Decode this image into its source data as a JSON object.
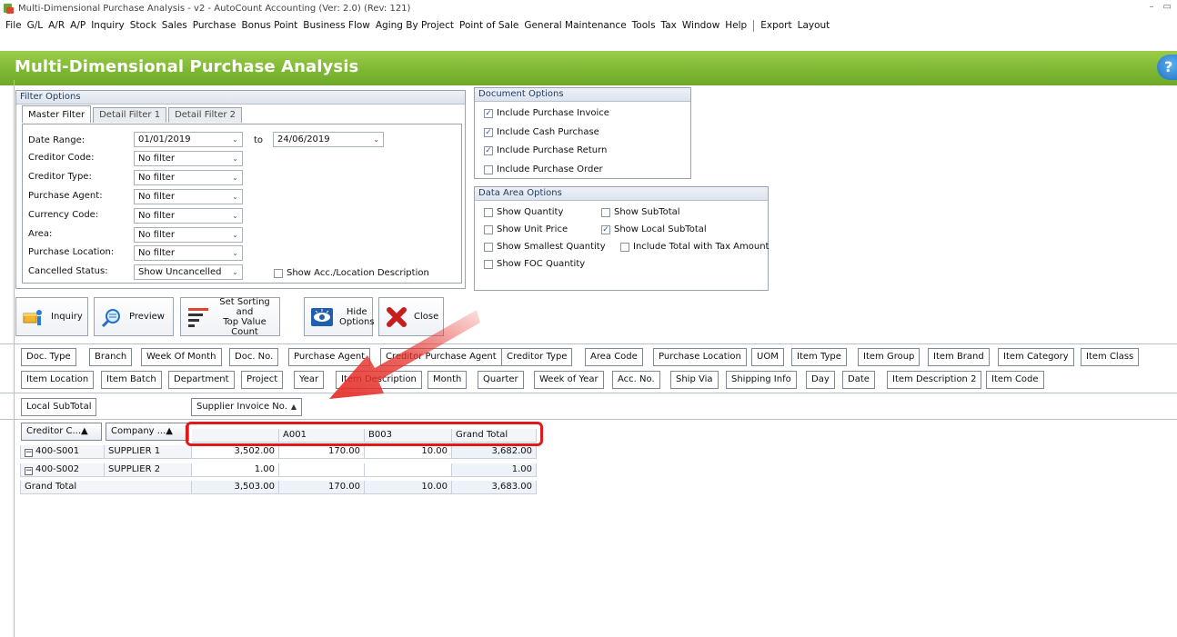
{
  "window": {
    "title": "Multi-Dimensional Purchase Analysis - v2 - AutoCount Accounting (Ver: 2.0) (Rev: 121)",
    "controls": [
      "–",
      "▭"
    ]
  },
  "menu": {
    "items_a": [
      "File",
      "G/L",
      "A/R",
      "A/P",
      "Inquiry",
      "Stock",
      "Sales",
      "Purchase",
      "Bonus Point",
      "Business Flow",
      "Aging By Project",
      "Point of Sale",
      "General Maintenance",
      "Tools",
      "Tax",
      "Window",
      "Help"
    ],
    "items_b": [
      "Export",
      "Layout"
    ]
  },
  "banner": {
    "title": "Multi-Dimensional Purchase Analysis",
    "help": "?"
  },
  "filter_options": {
    "header": "Filter Options",
    "tabs": [
      "Master Filter",
      "Detail Filter 1",
      "Detail Filter 2"
    ],
    "rows": [
      {
        "label": "Date Range:",
        "value": "01/01/2019"
      },
      {
        "label": "Creditor Code:",
        "value": "No filter"
      },
      {
        "label": "Creditor Type:",
        "value": "No filter"
      },
      {
        "label": "Purchase Agent:",
        "value": "No filter"
      },
      {
        "label": "Currency Code:",
        "value": "No filter"
      },
      {
        "label": "Area:",
        "value": "No filter"
      },
      {
        "label": "Purchase Location:",
        "value": "No filter"
      },
      {
        "label": "Cancelled Status:",
        "value": "Show Uncancelled"
      }
    ],
    "to_label": "to",
    "date_to": "24/06/2019",
    "show_acc_location": {
      "label": "Show Acc./Location Description",
      "checked": false
    }
  },
  "document_options": {
    "header": "Document Options",
    "items": [
      {
        "label": "Include Purchase Invoice",
        "checked": true
      },
      {
        "label": "Include Cash Purchase",
        "checked": true
      },
      {
        "label": "Include Purchase Return",
        "checked": true
      },
      {
        "label": "Include Purchase Order",
        "checked": false
      }
    ]
  },
  "data_area_options": {
    "header": "Data Area Options",
    "items": [
      {
        "label": "Show Quantity",
        "checked": false
      },
      {
        "label": "Show SubTotal",
        "checked": false
      },
      {
        "label": "Show Unit Price",
        "checked": false
      },
      {
        "label": "Show Local SubTotal",
        "checked": true
      },
      {
        "label": "Show Smallest Quantity",
        "checked": false
      },
      {
        "label": "Include Total with Tax Amount",
        "checked": false
      },
      {
        "label": "Show FOC Quantity",
        "checked": false
      }
    ]
  },
  "toolbar": {
    "inquiry": "Inquiry",
    "preview": "Preview",
    "sorting_line1": "Set Sorting and",
    "sorting_line2": "Top Value Count",
    "hide_line1": "Hide",
    "hide_line2": "Options",
    "close": "Close"
  },
  "field_list": {
    "row1": [
      "Doc. Type",
      "Branch",
      "Week Of Month",
      "Doc. No.",
      "Purchase Agent",
      "Creditor Purchase Agent",
      "Creditor Type",
      "Area Code",
      "Purchase Location",
      "UOM",
      "Item Type",
      "Item Group",
      "Item Brand",
      "Item Category",
      "Item Class"
    ],
    "row2": [
      "Item Location",
      "Item Batch",
      "Department",
      "Project",
      "Year",
      "Item Description",
      "Month",
      "Quarter",
      "Week of Year",
      "Acc. No.",
      "Ship Via",
      "Shipping Info",
      "Day",
      "Date",
      "Item Description 2",
      "Item Code"
    ]
  },
  "pivot": {
    "data_field": "Local SubTotal",
    "column_field": "Supplier Invoice No.",
    "row_fields": [
      "Creditor C...",
      "Company ..."
    ],
    "sort_glyph": "▲",
    "columns": [
      "",
      "A001",
      "B003",
      "Grand Total"
    ],
    "rows": [
      {
        "code": "400-S001",
        "name": "SUPPLIER 1",
        "values": [
          "3,502.00",
          "170.00",
          "10.00",
          "3,682.00"
        ]
      },
      {
        "code": "400-S002",
        "name": "SUPPLIER 2",
        "values": [
          "1.00",
          "",
          "",
          "1.00"
        ]
      }
    ],
    "grand_total": {
      "label": "Grand Total",
      "values": [
        "3,503.00",
        "170.00",
        "10.00",
        "3,683.00"
      ]
    },
    "expander": "−"
  },
  "colors": {
    "banner": "#7fb834",
    "highlight": "#e0191b",
    "arrow": "#e5312b"
  }
}
